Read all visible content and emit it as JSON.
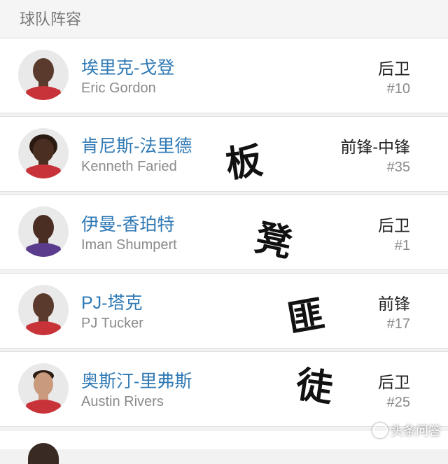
{
  "header": {
    "title": "球队阵容"
  },
  "players": [
    {
      "cn_name": "埃里克-戈登",
      "en_name": "Eric Gordon",
      "position": "后卫",
      "number": "#10",
      "jersey_color": "#c8333a",
      "skin": "#5a3a2c"
    },
    {
      "cn_name": "肯尼斯-法里德",
      "en_name": "Kenneth Faried",
      "position": "前锋-中锋",
      "number": "#35",
      "jersey_color": "#c8333a",
      "skin": "#4a2e22"
    },
    {
      "cn_name": "伊曼-香珀特",
      "en_name": "Iman Shumpert",
      "position": "后卫",
      "number": "#1",
      "jersey_color": "#5b3c8c",
      "skin": "#4a2e24"
    },
    {
      "cn_name": "PJ-塔克",
      "en_name": "PJ Tucker",
      "position": "前锋",
      "number": "#17",
      "jersey_color": "#c8333a",
      "skin": "#5a3a2c"
    },
    {
      "cn_name": "奥斯汀-里弗斯",
      "en_name": "Austin Rivers",
      "position": "后卫",
      "number": "#25",
      "jersey_color": "#c8333a",
      "skin": "#c99a7c"
    }
  ],
  "overlay_text": [
    "板",
    "凳",
    "匪",
    "徒"
  ],
  "watermark": {
    "text": "头条问答"
  }
}
